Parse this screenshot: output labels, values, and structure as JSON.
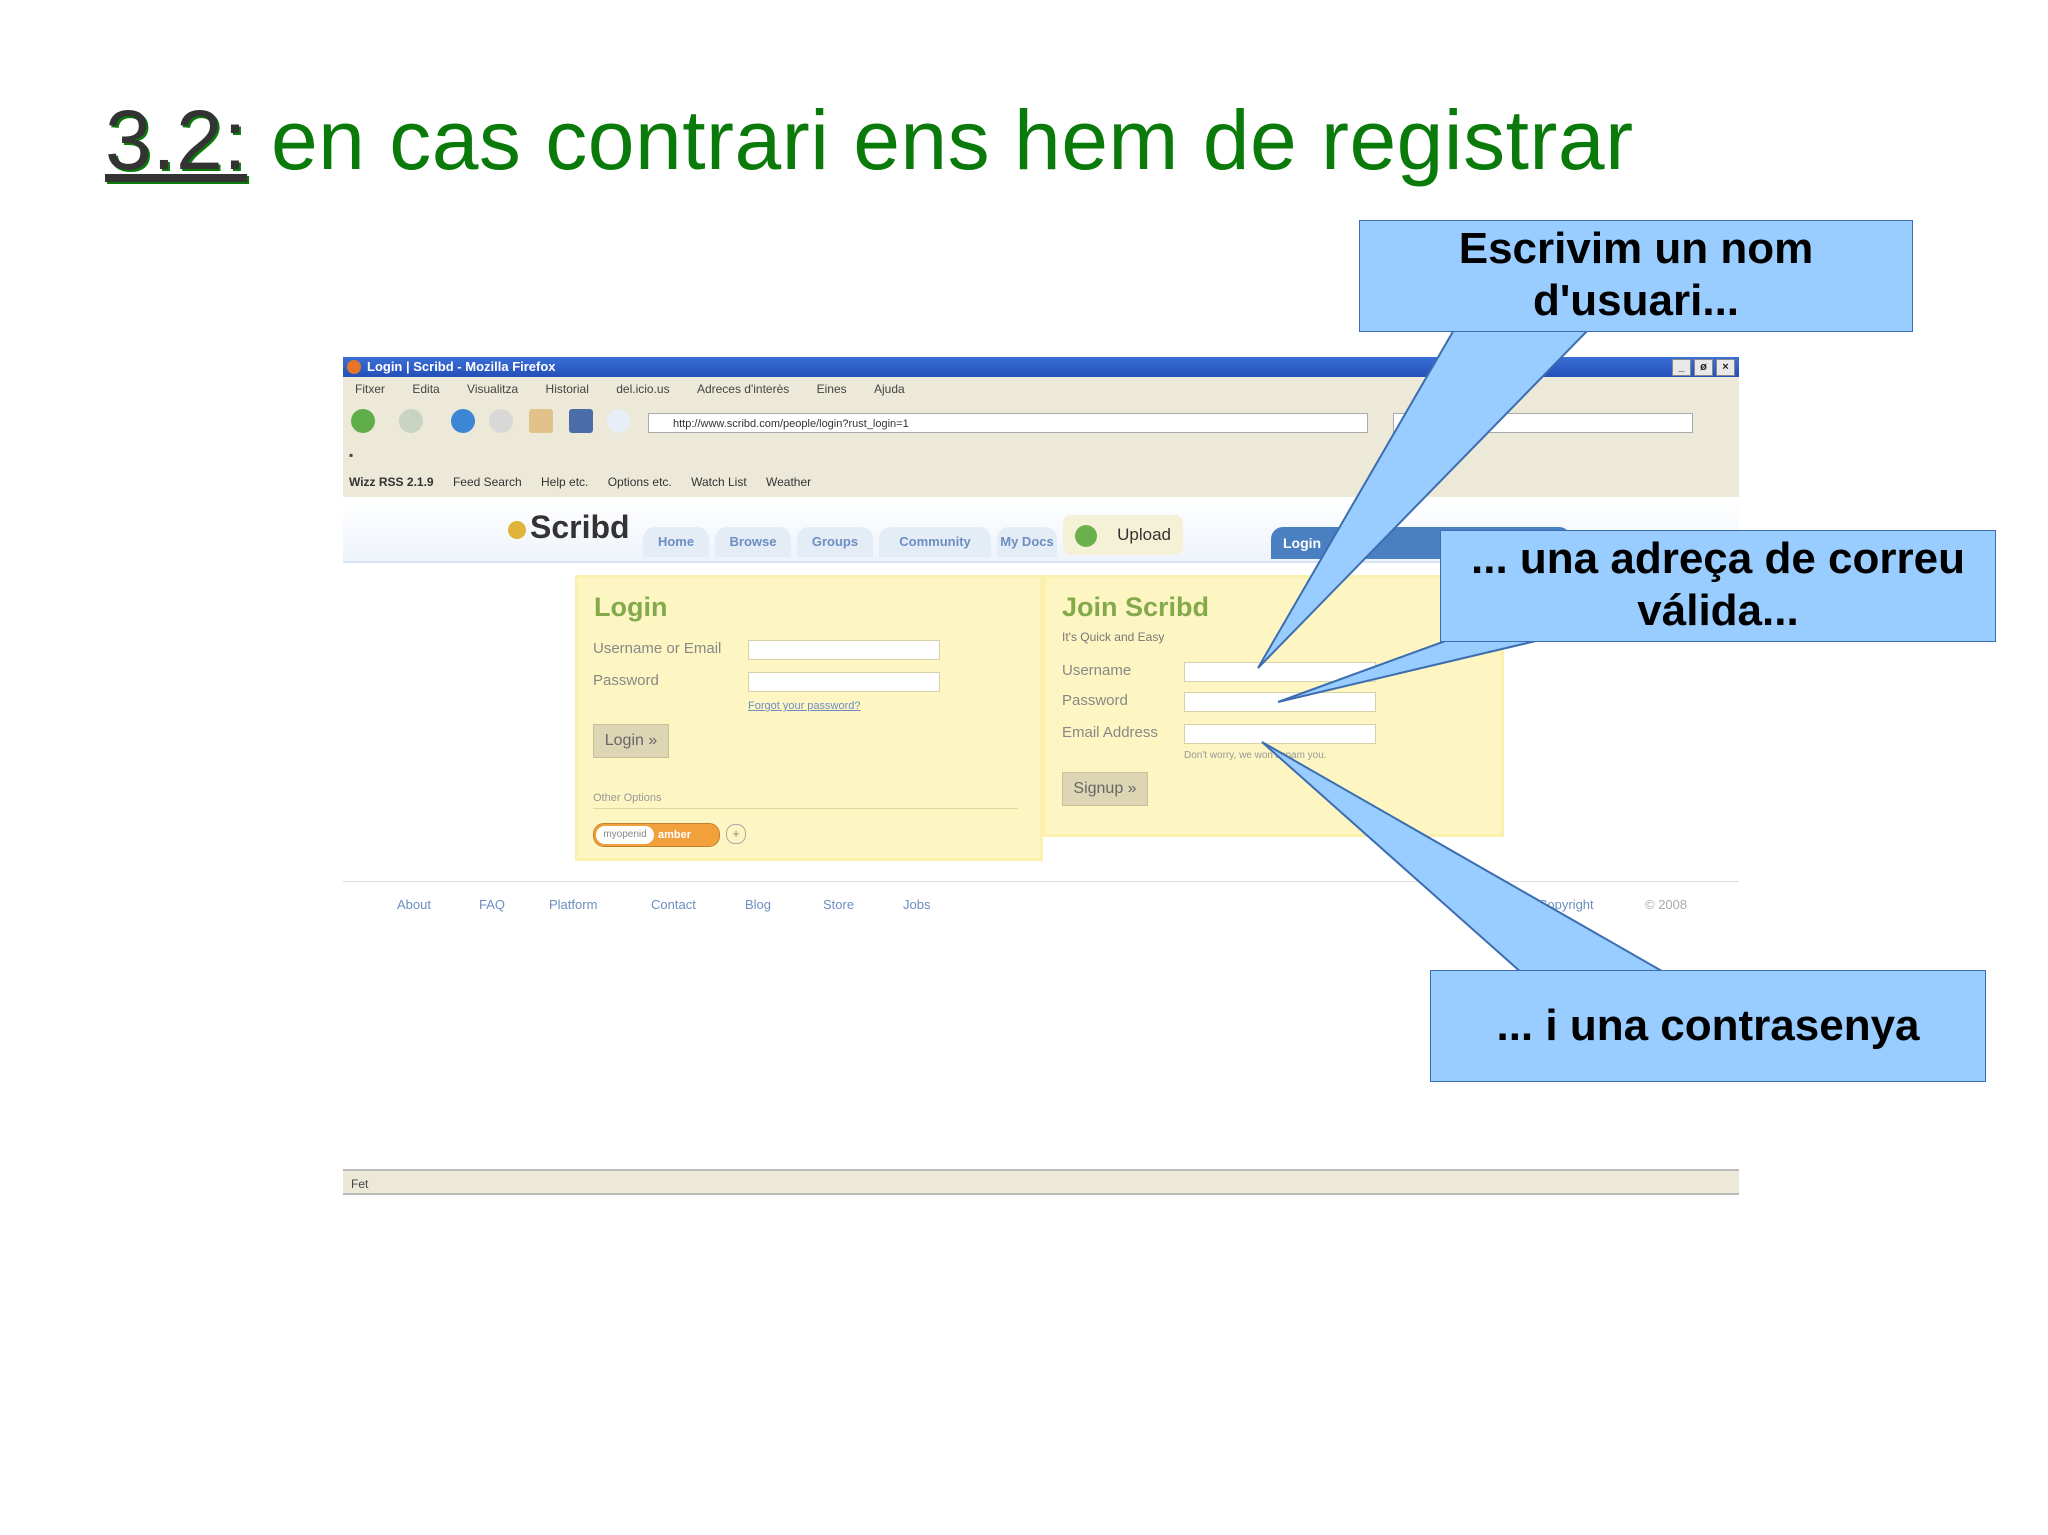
{
  "slide": {
    "title_num": "3.2:",
    "title_text": " en cas contrari ens hem de registrar"
  },
  "browser": {
    "window_title": "Login | Scribd - Mozilla Firefox",
    "window_buttons": [
      "_",
      "ø",
      "×"
    ],
    "menu": [
      "Fitxer",
      "Edita",
      "Visualitza",
      "Historial",
      "del.icio.us",
      "Adreces d'interès",
      "Eines",
      "Ajuda"
    ],
    "url": "http://www.scribd.com/people/login?rust_login=1",
    "bookmarks": {
      "wizz": "Wizz RSS 2.1.9",
      "items": [
        "Feed Search",
        "Help etc.",
        "Options etc.",
        "Watch List",
        "Weather"
      ]
    },
    "status": "Fet"
  },
  "site": {
    "logo": "Scribd",
    "tabs": [
      "Home",
      "Browse",
      "Groups",
      "Community",
      "My Docs"
    ],
    "upload": "Upload",
    "login_tab": "Login",
    "login": {
      "heading": "Login",
      "username_label": "Username or Email",
      "password_label": "Password",
      "forgot": "Forgot your password?",
      "button": "Login »",
      "other_options": "Other Options",
      "openid_left": "myopenid",
      "openid_right": "amber"
    },
    "join": {
      "heading": "Join Scribd",
      "tagline": "It's Quick and Easy",
      "username_label": "Username",
      "password_label": "Password",
      "email_label": "Email Address",
      "spam_note": "Don't worry, we won't spam you.",
      "button": "Signup »"
    },
    "footer": {
      "links": [
        "About",
        "FAQ",
        "Platform",
        "Contact",
        "Blog",
        "Store",
        "Jobs"
      ],
      "copyright": "Copyright",
      "year": "© 2008"
    }
  },
  "callouts": {
    "username": "Escrivim un nom d'usuari...",
    "email": "... una adreça de correu válida...",
    "password": "... i una contrasenya"
  },
  "colors": {
    "title_green": "#0a7a0a",
    "callout_fill": "#99ccff",
    "panel_fill": "#fdf6c3"
  }
}
